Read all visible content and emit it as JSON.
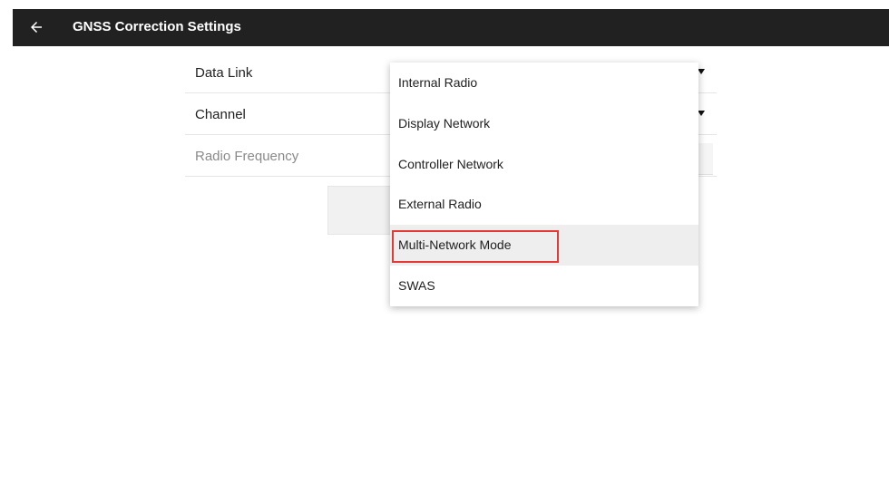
{
  "app_bar": {
    "title": "GNSS Correction Settings",
    "back_icon": "arrow-left-icon",
    "background_color": "#212121"
  },
  "form": {
    "rows": [
      {
        "label": "Data Link",
        "disabled": false,
        "has_dropdown": true
      },
      {
        "label": "Channel",
        "disabled": false,
        "has_dropdown": true
      },
      {
        "label": "Radio Frequency",
        "disabled": true,
        "has_dropdown": false
      }
    ]
  },
  "dropdown": {
    "options": [
      "Internal Radio",
      "Display Network",
      "Controller Network",
      "External Radio",
      "Multi-Network Mode",
      "SWAS"
    ],
    "selected": "Multi-Network Mode",
    "highlight_color": "#e53935"
  }
}
